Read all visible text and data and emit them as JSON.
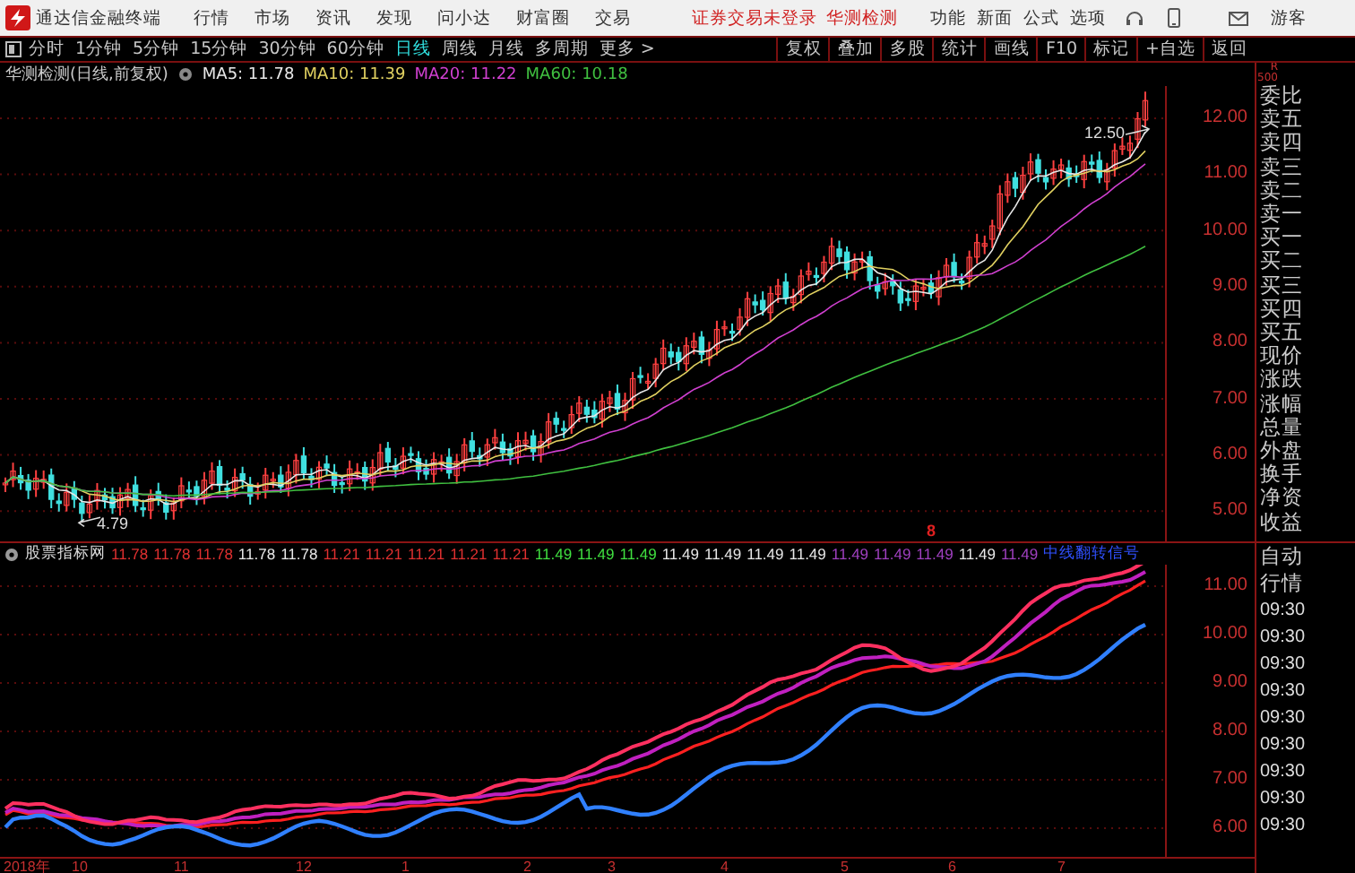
{
  "menubar": {
    "app_title": "通达信金融终端",
    "menus": [
      "行情",
      "市场",
      "资讯",
      "发现",
      "问小达",
      "财富圈",
      "交易"
    ],
    "login_status": "证券交易未登录",
    "stock_name": "华测检测",
    "actions": [
      "功能",
      "新面",
      "公式",
      "选项"
    ],
    "user": "游客"
  },
  "toolbar": {
    "periods": [
      {
        "label": "分时",
        "selected": false
      },
      {
        "label": "1分钟",
        "selected": false
      },
      {
        "label": "5分钟",
        "selected": false
      },
      {
        "label": "15分钟",
        "selected": false
      },
      {
        "label": "30分钟",
        "selected": false
      },
      {
        "label": "60分钟",
        "selected": false
      },
      {
        "label": "日线",
        "selected": true
      },
      {
        "label": "周线",
        "selected": false
      },
      {
        "label": "月线",
        "selected": false
      },
      {
        "label": "多周期",
        "selected": false
      },
      {
        "label": "更多 >",
        "selected": false
      }
    ],
    "buttons": [
      "复权",
      "叠加",
      "多股",
      "统计",
      "画线",
      "F10",
      "标记",
      "+自选",
      "返回"
    ]
  },
  "chart": {
    "title": "华测检测(日线,前复权)",
    "ma": [
      {
        "label": "MA5: 11.78",
        "color": "#e8e8e8"
      },
      {
        "label": "MA10: 11.39",
        "color": "#e0d060"
      },
      {
        "label": "MA20: 11.22",
        "color": "#d040d0"
      },
      {
        "label": "MA60: 10.18",
        "color": "#40c040"
      }
    ],
    "price_axis": [
      "12.00",
      "11.00",
      "10.00",
      "9.00",
      "8.00",
      "7.00",
      "6.00",
      "5.00"
    ],
    "high_label": "12.50",
    "low_label": "4.79",
    "marker": "8"
  },
  "indicator": {
    "name": "股票指标网",
    "values": [
      {
        "text": "11.78",
        "color": "#e03030"
      },
      {
        "text": "11.78",
        "color": "#e03030"
      },
      {
        "text": "11.78",
        "color": "#e03030"
      },
      {
        "text": "11.78",
        "color": "#e8e8e8"
      },
      {
        "text": "11.78",
        "color": "#e8e8e8"
      },
      {
        "text": "11.21",
        "color": "#e03030"
      },
      {
        "text": "11.21",
        "color": "#e03030"
      },
      {
        "text": "11.21",
        "color": "#e03030"
      },
      {
        "text": "11.21",
        "color": "#e03030"
      },
      {
        "text": "11.21",
        "color": "#e03030"
      },
      {
        "text": "11.49",
        "color": "#40e040"
      },
      {
        "text": "11.49",
        "color": "#40e040"
      },
      {
        "text": "11.49",
        "color": "#40e040"
      },
      {
        "text": "11.49",
        "color": "#e8e8e8"
      },
      {
        "text": "11.49",
        "color": "#e8e8e8"
      },
      {
        "text": "11.49",
        "color": "#e8e8e8"
      },
      {
        "text": "11.49",
        "color": "#e8e8e8"
      },
      {
        "text": "11.49",
        "color": "#a040c0"
      },
      {
        "text": "11.49",
        "color": "#a040c0"
      },
      {
        "text": "11.49",
        "color": "#a040c0"
      },
      {
        "text": "11.49",
        "color": "#e8e8e8"
      },
      {
        "text": "11.49",
        "color": "#a040c0"
      }
    ],
    "signal": "中线翻转信号",
    "axis": [
      "11.00",
      "10.00",
      "9.00",
      "8.00",
      "7.00",
      "6.00"
    ]
  },
  "time_axis": [
    "2018年",
    "10",
    "11",
    "12",
    "1",
    "2",
    "3",
    "4",
    "5",
    "6",
    "7"
  ],
  "sidebar": {
    "header": [
      "R",
      "500"
    ],
    "quote_labels": [
      "委比",
      "卖五",
      "卖四",
      "卖三",
      "卖二",
      "卖一",
      "买一",
      "买二",
      "买三",
      "买四",
      "买五",
      "现价",
      "涨跌",
      "涨幅",
      "总量",
      "外盘",
      "换手",
      "净资",
      "收益"
    ],
    "tabs": [
      "自动",
      "行情"
    ],
    "times": [
      "09:30",
      "09:30",
      "09:30",
      "09:30",
      "09:30",
      "09:30",
      "09:30",
      "09:30",
      "09:30"
    ]
  }
}
